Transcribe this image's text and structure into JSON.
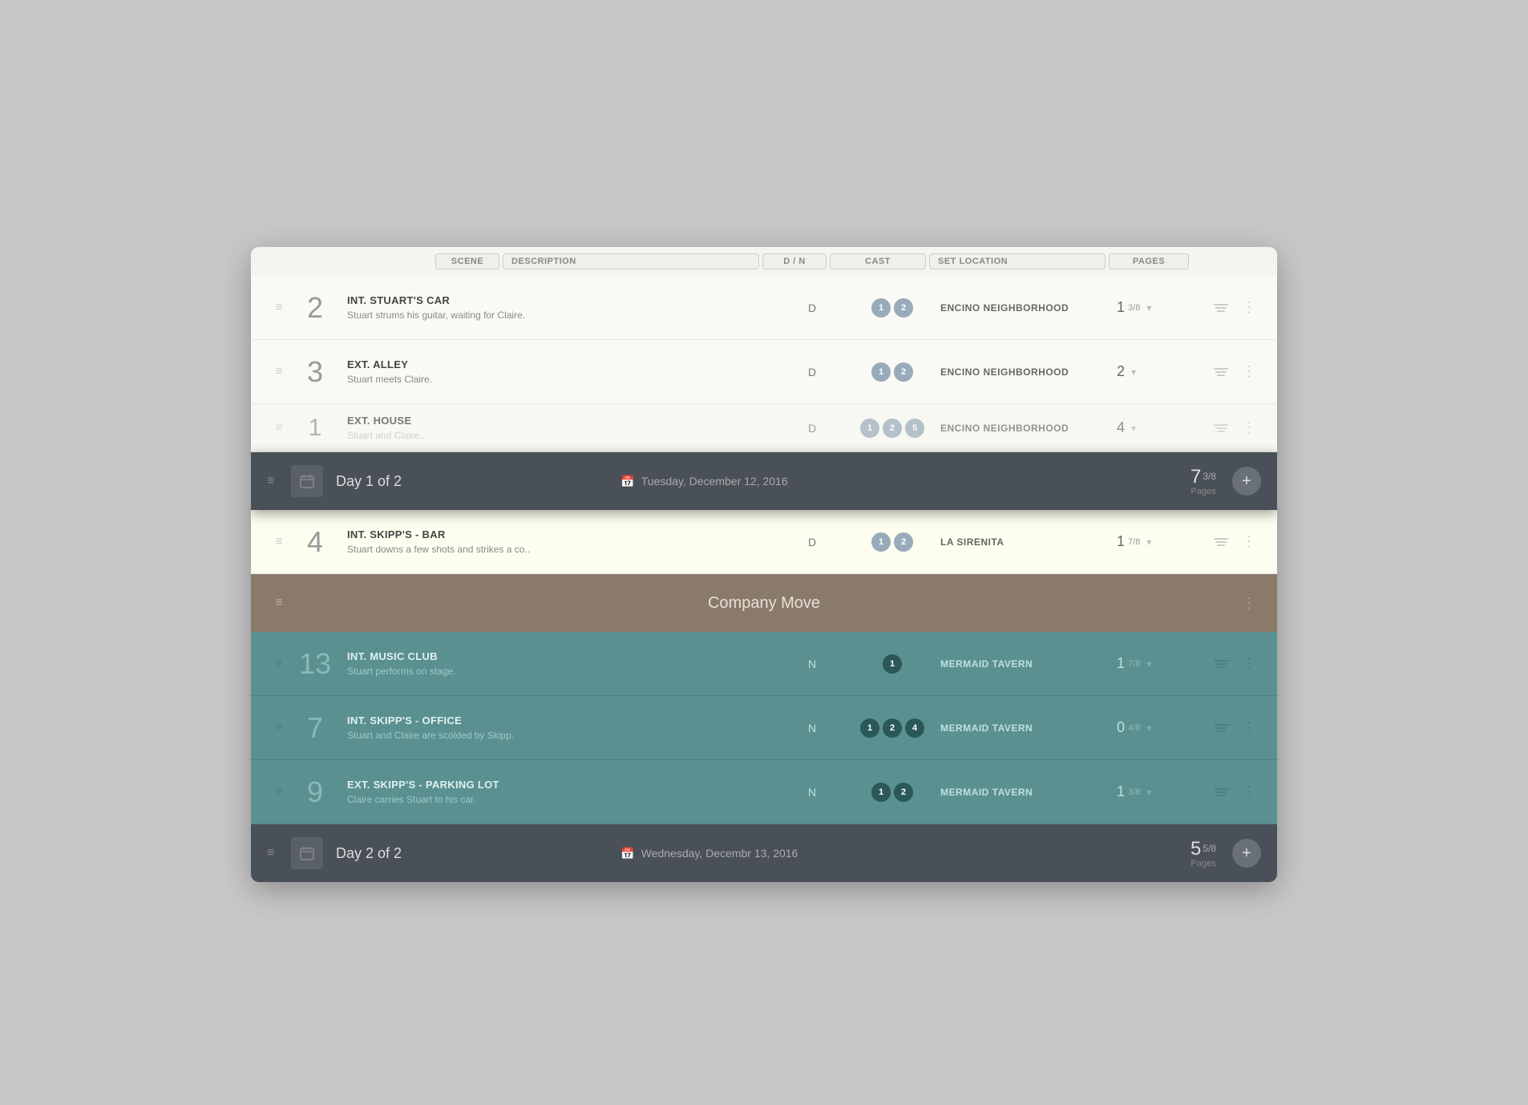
{
  "columns": {
    "scene": "SCENE",
    "description": "DESCRIPTION",
    "dm": "D / N",
    "cast": "CAST",
    "set_location": "SET LOCATION",
    "pages": "PAGES"
  },
  "day1": {
    "label": "Day 1 of 2",
    "date": "Tuesday, December 12, 2016",
    "pages_num": "7",
    "pages_frac": "3/8",
    "pages_label": "Pages"
  },
  "day2": {
    "label": "Day 2 of 2",
    "date": "Wednesday, Decembr 13, 2016",
    "pages_num": "5",
    "pages_frac": "5/8",
    "pages_label": "Pages"
  },
  "scenes": [
    {
      "num": "2",
      "title": "INT. STUART'S CAR",
      "desc": "Stuart strums his guitar, waiting for Claire.",
      "dm": "D",
      "cast": [
        "1",
        "2"
      ],
      "location": "ENCINO NEIGHBORHOOD",
      "pages_main": "1",
      "pages_frac": "3/8",
      "type": "day"
    },
    {
      "num": "3",
      "title": "EXT. ALLEY",
      "desc": "Stuart meets Claire.",
      "dm": "D",
      "cast": [
        "1",
        "2"
      ],
      "location": "ENCINO NEIGHBORHOOD",
      "pages_main": "2",
      "pages_frac": "",
      "type": "day"
    },
    {
      "num": "1",
      "title": "EXT. HOUSE",
      "desc": "Stuart and Claire...",
      "dm": "D",
      "cast": [
        "1",
        "2",
        "5"
      ],
      "location": "ENCINO NEIGHBORHOOD",
      "pages_main": "4",
      "pages_frac": "",
      "type": "day"
    },
    {
      "num": "4",
      "title": "INT. SKIPP'S - BAR",
      "desc": "Stuart downs a few shots and strikes a co..",
      "dm": "D",
      "cast": [
        "1",
        "2"
      ],
      "location": "LA SIRENITA",
      "pages_main": "1",
      "pages_frac": "7/8",
      "type": "day"
    }
  ],
  "company_move": "Company Move",
  "night_scenes": [
    {
      "num": "13",
      "title": "INT. MUSIC CLUB",
      "desc": "Stuart performs on stage.",
      "dm": "N",
      "cast": [
        "1"
      ],
      "location": "MERMAID TAVERN",
      "pages_main": "1",
      "pages_frac": "7/8",
      "type": "night"
    },
    {
      "num": "7",
      "title": "INT. SKIPP'S - OFFICE",
      "desc": "Stuart and Claire are scolded by Skipp.",
      "dm": "N",
      "cast": [
        "1",
        "2",
        "4"
      ],
      "location": "MERMAID TAVERN",
      "pages_main": "0",
      "pages_frac": "4/8",
      "type": "night"
    },
    {
      "num": "9",
      "title": "EXT. SKIPP'S - PARKING LOT",
      "desc": "Claire carries Stuart to his car.",
      "dm": "N",
      "cast": [
        "1",
        "2"
      ],
      "location": "MERMAID TAVERN",
      "pages_main": "1",
      "pages_frac": "3/8",
      "type": "night"
    }
  ]
}
